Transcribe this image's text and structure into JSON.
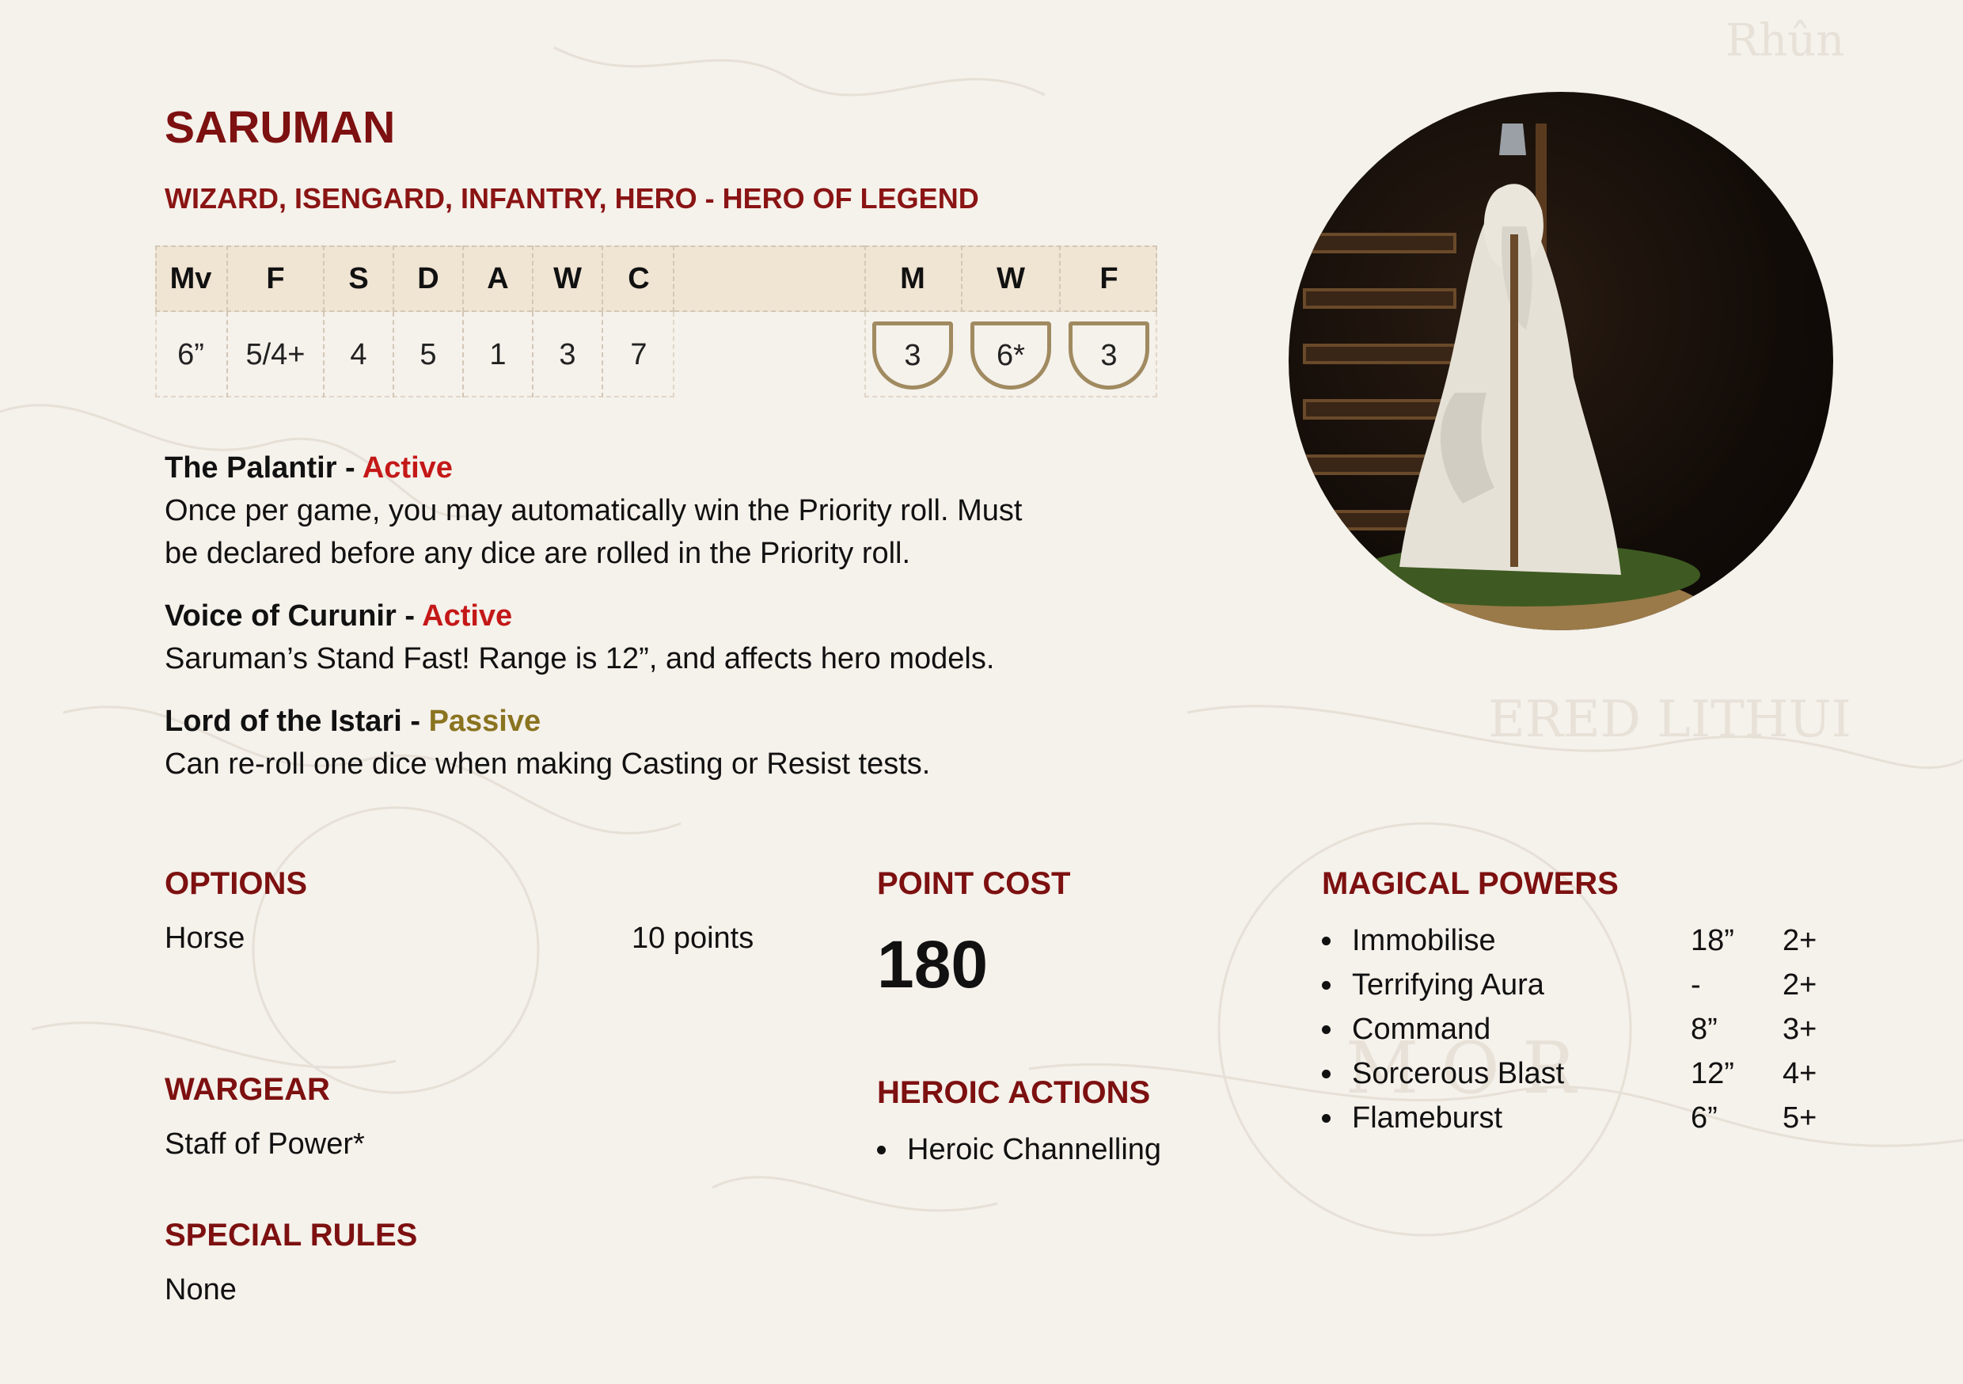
{
  "unit": {
    "name": "SARUMAN",
    "keywords": "WIZARD, ISENGARD, INFANTRY, HERO - HERO OF LEGEND"
  },
  "stats": {
    "headers": [
      "Mv",
      "F",
      "S",
      "D",
      "A",
      "W",
      "C"
    ],
    "values": [
      "6”",
      "5/4+",
      "4",
      "5",
      "1",
      "3",
      "7"
    ]
  },
  "hero_stats": {
    "headers": [
      "M",
      "W",
      "F"
    ],
    "values": [
      "3",
      "6*",
      "3"
    ]
  },
  "rules": [
    {
      "name": "The Palantir - ",
      "type": "Active",
      "text_1": "Once per game, you may automatically win the Priority roll. Must",
      "text_2": "be declared before any dice are rolled in the Priority roll."
    },
    {
      "name": "Voice of Curunir - ",
      "type": "Active",
      "text_1": "Saruman’s Stand Fast! Range is 12”, and affects hero models."
    },
    {
      "name": "Lord of the Istari - ",
      "type": "Passive",
      "text_1": "Can re-roll one dice when making Casting or Resist tests."
    }
  ],
  "options": {
    "heading": "OPTIONS",
    "items": [
      {
        "name": "Horse",
        "cost": "10 points"
      }
    ]
  },
  "point_cost": {
    "heading": "POINT COST",
    "value": "180"
  },
  "wargear": {
    "heading": "WARGEAR",
    "text": "Staff of Power*"
  },
  "special_rules": {
    "heading": "SPECIAL RULES",
    "text": "None"
  },
  "heroic_actions": {
    "heading": "HEROIC ACTIONS",
    "items": [
      "Heroic Channelling"
    ]
  },
  "magical_powers": {
    "heading": "MAGICAL POWERS",
    "items": [
      {
        "name": "Immobilise",
        "range": "18”",
        "cast": "2+"
      },
      {
        "name": "Terrifying Aura",
        "range": "-",
        "cast": "2+"
      },
      {
        "name": "Command",
        "range": "8”",
        "cast": "3+"
      },
      {
        "name": "Sorcerous Blast",
        "range": "12”",
        "cast": "4+"
      },
      {
        "name": "Flameburst",
        "range": "6”",
        "cast": "5+"
      }
    ]
  },
  "colors": {
    "heading": "#7d1010",
    "active": "#c41818",
    "passive": "#8a7420",
    "table_header": "#f0e4d3",
    "shield": "#a08a60"
  }
}
